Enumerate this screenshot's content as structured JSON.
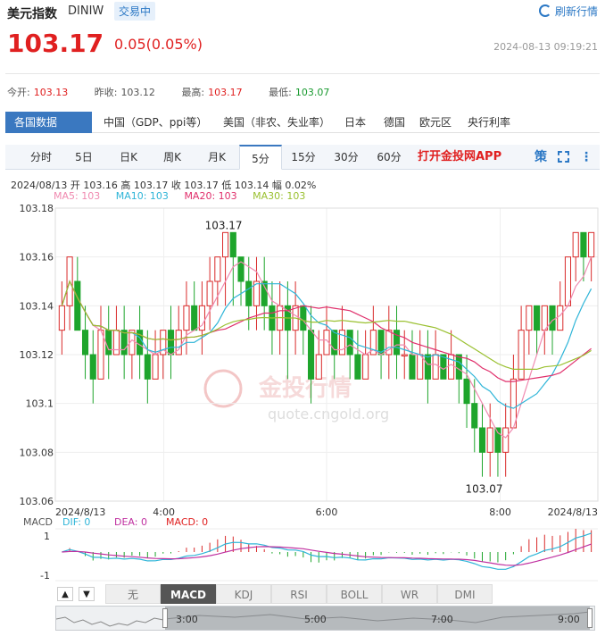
{
  "header": {
    "title": "美元指数",
    "code": "DINIW",
    "status_badge": "交易中",
    "refresh_label": "刷新行情",
    "price": "103.17",
    "change": "0.05(0.05%)",
    "timestamp": "2024-08-13 09:19:21"
  },
  "stats": [
    {
      "label": "今开:",
      "value": "103.13",
      "color": "red"
    },
    {
      "label": "昨收:",
      "value": "103.12",
      "color": "neutral"
    },
    {
      "label": "最高:",
      "value": "103.17",
      "color": "red"
    },
    {
      "label": "最低:",
      "value": "103.07",
      "color": "green"
    }
  ],
  "category_tabs": [
    "各国数据",
    "中国（GDP、ppi等）",
    "美国（非农、失业率）",
    "日本",
    "德国",
    "欧元区",
    "央行利率"
  ],
  "period_tabs": [
    "分时",
    "5日",
    "日K",
    "周K",
    "月K",
    "5分",
    "15分",
    "30分",
    "60分"
  ],
  "active_period": "5分",
  "app_banner": "打开金投网APP",
  "icons": [
    "strategy-icon",
    "fullscreen-icon",
    "more-icon"
  ],
  "strategy_glyph": "策",
  "ohlc_line": "2024/08/13  开 103.16  高 103.17  收 103.17  低 103.14  幅 0.02%",
  "ma_legend": [
    {
      "label": "MA5: 103",
      "color": "#f08ab0"
    },
    {
      "label": "MA10: 103",
      "color": "#2fb5d8"
    },
    {
      "label": "MA20: 103",
      "color": "#e0306c"
    },
    {
      "label": "MA30: 103",
      "color": "#9ac030"
    }
  ],
  "watermark": {
    "brand": "金投行情",
    "url": "quote.cngold.org"
  },
  "chart_data": {
    "type": "candlestick",
    "ylim": [
      103.06,
      103.18
    ],
    "y_ticks": [
      "103.18",
      "103.16",
      "103.14",
      "103.12",
      "103.1",
      "103.08",
      "103.06"
    ],
    "x_ticks": [
      "2024/8/13",
      "4:00",
      "6:00",
      "8:00",
      "2024/8/13"
    ],
    "x_tick_positions": [
      0,
      0.2,
      0.5,
      0.82,
      1
    ],
    "annotations": [
      {
        "label": "103.17",
        "kind": "high"
      },
      {
        "label": "103.07",
        "kind": "low"
      }
    ],
    "candles": [
      [
        103.13,
        103.14,
        103.15,
        103.12
      ],
      [
        103.14,
        103.16,
        103.16,
        103.13
      ],
      [
        103.15,
        103.13,
        103.16,
        103.13
      ],
      [
        103.13,
        103.12,
        103.14,
        103.11
      ],
      [
        103.12,
        103.11,
        103.13,
        103.1
      ],
      [
        103.11,
        103.13,
        103.14,
        103.11
      ],
      [
        103.13,
        103.12,
        103.14,
        103.11
      ],
      [
        103.12,
        103.13,
        103.14,
        103.12
      ],
      [
        103.13,
        103.12,
        103.14,
        103.11
      ],
      [
        103.12,
        103.13,
        103.13,
        103.11
      ],
      [
        103.13,
        103.12,
        103.14,
        103.11
      ],
      [
        103.12,
        103.11,
        103.13,
        103.1
      ],
      [
        103.11,
        103.12,
        103.13,
        103.11
      ],
      [
        103.12,
        103.13,
        103.13,
        103.11
      ],
      [
        103.13,
        103.12,
        103.14,
        103.11
      ],
      [
        103.12,
        103.13,
        103.14,
        103.12
      ],
      [
        103.13,
        103.14,
        103.15,
        103.12
      ],
      [
        103.14,
        103.13,
        103.15,
        103.13
      ],
      [
        103.13,
        103.14,
        103.15,
        103.12
      ],
      [
        103.14,
        103.15,
        103.16,
        103.13
      ],
      [
        103.15,
        103.16,
        103.16,
        103.14
      ],
      [
        103.16,
        103.17,
        103.17,
        103.14
      ],
      [
        103.17,
        103.16,
        103.17,
        103.14
      ],
      [
        103.16,
        103.15,
        103.16,
        103.14
      ],
      [
        103.15,
        103.14,
        103.16,
        103.13
      ],
      [
        103.14,
        103.15,
        103.16,
        103.13
      ],
      [
        103.15,
        103.14,
        103.16,
        103.13
      ],
      [
        103.14,
        103.13,
        103.15,
        103.12
      ],
      [
        103.13,
        103.14,
        103.15,
        103.12
      ],
      [
        103.14,
        103.13,
        103.15,
        103.11
      ],
      [
        103.13,
        103.14,
        103.15,
        103.12
      ],
      [
        103.14,
        103.13,
        103.14,
        103.12
      ],
      [
        103.13,
        103.11,
        103.14,
        103.1
      ],
      [
        103.11,
        103.12,
        103.13,
        103.11
      ],
      [
        103.12,
        103.13,
        103.14,
        103.12
      ],
      [
        103.13,
        103.12,
        103.13,
        103.11
      ],
      [
        103.12,
        103.13,
        103.14,
        103.12
      ],
      [
        103.13,
        103.12,
        103.13,
        103.11
      ],
      [
        103.12,
        103.11,
        103.13,
        103.11
      ],
      [
        103.11,
        103.12,
        103.13,
        103.11
      ],
      [
        103.12,
        103.13,
        103.14,
        103.12
      ],
      [
        103.13,
        103.12,
        103.13,
        103.11
      ],
      [
        103.12,
        103.13,
        103.14,
        103.11
      ],
      [
        103.13,
        103.12,
        103.14,
        103.11
      ],
      [
        103.12,
        103.12,
        103.13,
        103.11
      ],
      [
        103.12,
        103.11,
        103.13,
        103.11
      ],
      [
        103.11,
        103.12,
        103.13,
        103.11
      ],
      [
        103.12,
        103.11,
        103.13,
        103.1
      ],
      [
        103.11,
        103.12,
        103.13,
        103.11
      ],
      [
        103.12,
        103.11,
        103.12,
        103.11
      ],
      [
        103.11,
        103.12,
        103.13,
        103.11
      ],
      [
        103.12,
        103.11,
        103.12,
        103.1
      ],
      [
        103.11,
        103.1,
        103.12,
        103.09
      ],
      [
        103.1,
        103.09,
        103.11,
        103.08
      ],
      [
        103.09,
        103.08,
        103.1,
        103.07
      ],
      [
        103.08,
        103.09,
        103.1,
        103.07
      ],
      [
        103.09,
        103.08,
        103.09,
        103.07
      ],
      [
        103.08,
        103.09,
        103.1,
        103.07
      ],
      [
        103.09,
        103.11,
        103.12,
        103.09
      ],
      [
        103.11,
        103.13,
        103.14,
        103.11
      ],
      [
        103.13,
        103.14,
        103.14,
        103.12
      ],
      [
        103.14,
        103.13,
        103.14,
        103.12
      ],
      [
        103.13,
        103.14,
        103.14,
        103.12
      ],
      [
        103.14,
        103.13,
        103.14,
        103.12
      ],
      [
        103.13,
        103.14,
        103.15,
        103.13
      ],
      [
        103.14,
        103.16,
        103.16,
        103.14
      ],
      [
        103.16,
        103.17,
        103.17,
        103.15
      ],
      [
        103.17,
        103.16,
        103.17,
        103.15
      ],
      [
        103.16,
        103.17,
        103.17,
        103.15
      ]
    ],
    "candle_fields": [
      "open",
      "close",
      "high",
      "low"
    ],
    "series": [
      {
        "name": "MA5",
        "color": "#f08ab0"
      },
      {
        "name": "MA10",
        "color": "#2fb5d8"
      },
      {
        "name": "MA20",
        "color": "#e0306c"
      },
      {
        "name": "MA30",
        "color": "#9ac030"
      }
    ]
  },
  "macd": {
    "legend": [
      {
        "label": "MACD",
        "color": "#555"
      },
      {
        "label": "DIF: 0",
        "color": "#2fb5d8"
      },
      {
        "label": "DEA: 0",
        "color": "#c030a0"
      },
      {
        "label": "MACD: 0",
        "color": "#e02020"
      }
    ],
    "y_ticks": [
      "1",
      "-1"
    ]
  },
  "indicator_tabs": [
    "无",
    "MACD",
    "KDJ",
    "RSI",
    "BOLL",
    "WR",
    "DMI"
  ],
  "active_indicator": "MACD",
  "navigator_labels": [
    "3:00",
    "5:00",
    "7:00",
    "9:00"
  ],
  "arrows": [
    "▲",
    "▼"
  ]
}
